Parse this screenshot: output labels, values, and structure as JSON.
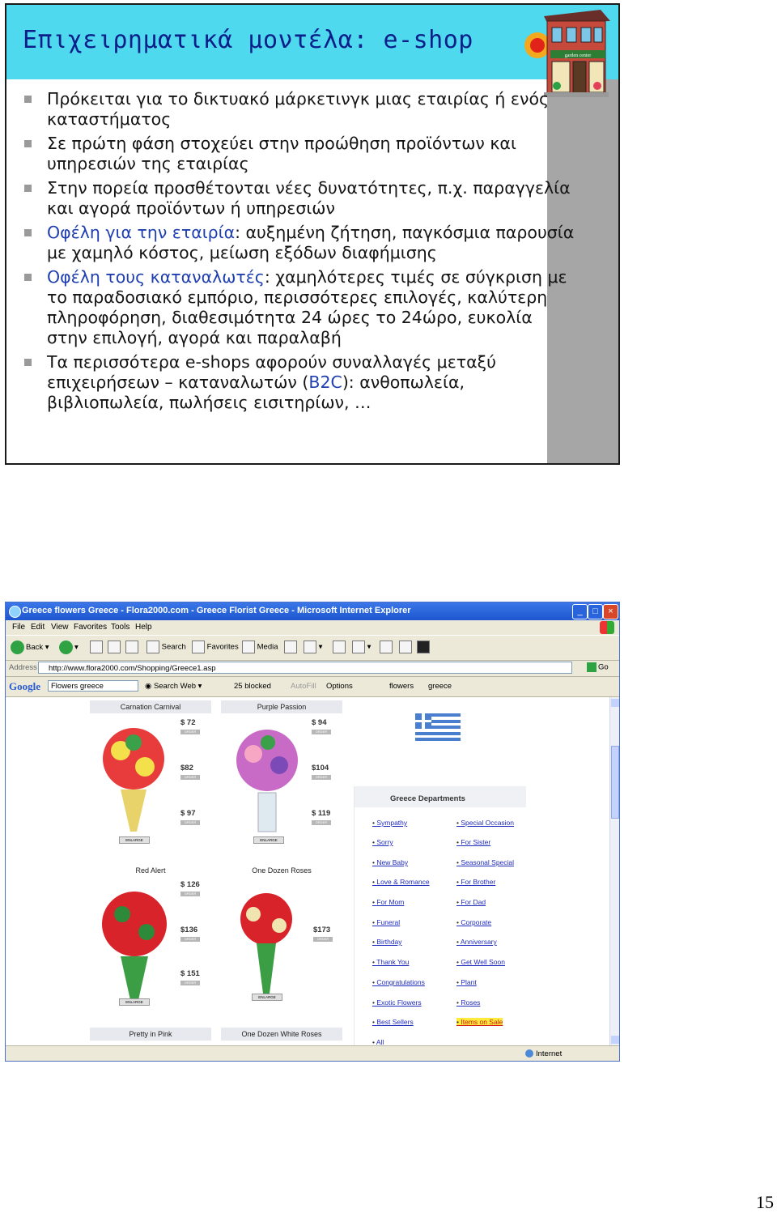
{
  "slide": {
    "title": "Επιχειρηματικά μοντέλα: e-shop",
    "building_sign": "garden center",
    "bullets": [
      {
        "blue": "",
        "text": "Πρόκειται για το δικτυακό μάρκετινγκ μιας εταιρίας ή ενός καταστήματος"
      },
      {
        "blue": "",
        "text": "Σε πρώτη φάση στοχεύει στην προώθηση προϊόντων και υπηρεσιών της εταιρίας"
      },
      {
        "blue": "",
        "text": "Στην πορεία προσθέτονται νέες δυνατότητες, π.χ. παραγγελία και αγορά προϊόντων ή υπηρεσιών"
      },
      {
        "blue": "Οφέλη για την εταιρία",
        "text": ": αυξημένη ζήτηση, παγκόσμια παρουσία με χαμηλό κόστος, μείωση εξόδων διαφήμισης"
      },
      {
        "blue": "Οφέλη τους καταναλωτές",
        "text": ": χαμηλότερες τιμές σε σύγκριση με το παραδοσιακό εμπόριο, περισσότερες επιλογές, καλύτερη πληροφόρηση, διαθεσιμότητα 24 ώρες το 24ώρο, ευκολία στην επιλογή, αγορά και παραλαβή"
      }
    ],
    "last_bullet": {
      "pre": "Τα περισσότερα e-shops αφορούν συναλλαγές μεταξύ επιχειρήσεων – καταναλωτών (",
      "blue": "B2C",
      "post": "): ανθοπωλεία, βιβλιοπωλεία, πωλήσεις εισιτηρίων, …"
    }
  },
  "browser": {
    "window_title": "Greece flowers Greece - Flora2000.com - Greece Florist Greece - Microsoft Internet Explorer",
    "menu": [
      "File",
      "Edit",
      "View",
      "Favorites",
      "Tools",
      "Help"
    ],
    "toolbar": {
      "back": "Back",
      "search": "Search",
      "favorites": "Favorites",
      "media": "Media"
    },
    "address_label": "Address",
    "address_value": "http://www.flora2000.com/Shopping/Greece1.asp",
    "go": "Go",
    "google": {
      "logo": "Google",
      "query": "Flowers greece",
      "search_web": "Search Web",
      "blocked": "25 blocked",
      "autofill": "AutoFill",
      "options": "Options",
      "flowers": "flowers",
      "greece": "greece"
    },
    "status": "Internet",
    "products": [
      {
        "name": "Carnation Carnival",
        "prices": [
          "$ 72",
          "$82",
          "$ 97"
        ]
      },
      {
        "name": "Purple Passion",
        "prices": [
          "$ 94",
          "$104",
          "$ 119"
        ]
      },
      {
        "name": "Red Alert",
        "prices": [
          "$ 126",
          "$136",
          "$ 151"
        ]
      },
      {
        "name": "One Dozen Roses",
        "prices": [
          "$173"
        ]
      }
    ],
    "bottom_labels": [
      "Pretty in Pink",
      "One Dozen White Roses"
    ],
    "order_label": "ORDER",
    "enlarge_label": "ENLARGE",
    "departments_title": "Greece Departments",
    "departments_left": [
      "Sympathy",
      "Sorry",
      "New Baby",
      "Love & Romance",
      "For Mom",
      "Funeral",
      "Birthday",
      "Thank You",
      "Congratulations",
      "Exotic Flowers",
      "Best Sellers",
      "All"
    ],
    "departments_right": [
      "Special Occasion",
      "For Sister",
      "Seasonal Special",
      "For Brother",
      "For Dad",
      "Corporate",
      "Anniversary",
      "Get Well Soon",
      "Plant",
      "Roses",
      "Items on Sale"
    ]
  },
  "page_number": "15",
  "colors": {
    "header": "#4fd9ee",
    "title": "#0b1f8a",
    "accent_blue": "#1f3fb0"
  }
}
